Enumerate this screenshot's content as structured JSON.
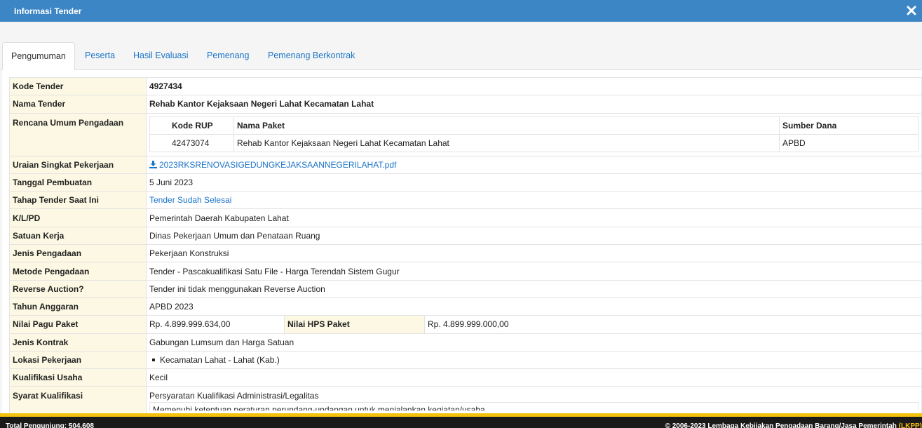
{
  "window": {
    "title": "Informasi Tender"
  },
  "tabs": [
    {
      "label": "Pengumuman",
      "active": true
    },
    {
      "label": "Peserta"
    },
    {
      "label": "Hasil Evaluasi"
    },
    {
      "label": "Pemenang"
    },
    {
      "label": "Pemenang Berkontrak"
    }
  ],
  "labels": {
    "kode_tender": "Kode Tender",
    "nama_tender": "Nama Tender",
    "rup": "Rencana Umum Pengadaan",
    "uraian": "Uraian Singkat Pekerjaan",
    "tanggal": "Tanggal Pembuatan",
    "tahap": "Tahap Tender Saat Ini",
    "klpd": "K/L/PD",
    "satker": "Satuan Kerja",
    "jenis_pengadaan": "Jenis Pengadaan",
    "metode": "Metode Pengadaan",
    "reverse": "Reverse Auction?",
    "tahun": "Tahun Anggaran",
    "pagu": "Nilai Pagu Paket",
    "hps": "Nilai HPS Paket",
    "kontrak": "Jenis Kontrak",
    "lokasi": "Lokasi Pekerjaan",
    "kualifikasi": "Kualifikasi Usaha",
    "syarat": "Syarat Kualifikasi"
  },
  "values": {
    "kode_tender": "4927434",
    "nama_tender": "Rehab Kantor Kejaksaan Negeri Lahat Kecamatan Lahat",
    "uraian_file": "2023RKSRENOVASIGEDUNGKEJAKSAANNEGERILAHAT.pdf",
    "tanggal": "5 Juni 2023",
    "tahap": "Tender Sudah Selesai",
    "klpd": "Pemerintah Daerah Kabupaten Lahat",
    "satker": "Dinas Pekerjaan Umum dan Penataan Ruang",
    "jenis_pengadaan": "Pekerjaan Konstruksi",
    "metode": "Tender - Pascakualifikasi Satu File - Harga Terendah Sistem Gugur",
    "reverse": "Tender ini tidak menggunakan Reverse Auction",
    "tahun": "APBD 2023",
    "pagu": "Rp. 4.899.999.634,00",
    "hps": "Rp. 4.899.999.000,00",
    "kontrak": "Gabungan Lumsum dan Harga Satuan",
    "lokasi": "Kecamatan Lahat - Lahat (Kab.)",
    "kualifikasi": "Kecil",
    "syarat_heading": "Persyaratan Kualifikasi Administrasi/Legalitas",
    "syarat_item": "Memenuhi ketentuan peraturan perundang-undangan untuk menjalankan kegiatan/usaha"
  },
  "rup_table": {
    "headers": [
      "Kode RUP",
      "Nama Paket",
      "Sumber Dana"
    ],
    "row": [
      "42473074",
      "Rehab Kantor Kejaksaan Negeri Lahat Kecamatan Lahat",
      "APBD"
    ]
  },
  "footer": {
    "left": "Total Pengunjung: 504.608",
    "right": "© 2006-2023 Lembaga Kebijakan Pengadaan Barang/Jasa Pemerintah",
    "right_highlight": " (LKPP)"
  },
  "colors": {
    "titlebar": "#3d86c6",
    "label_bg": "#fcf8e3",
    "link": "#1a73c8",
    "footer_accent": "#f4c20d"
  }
}
